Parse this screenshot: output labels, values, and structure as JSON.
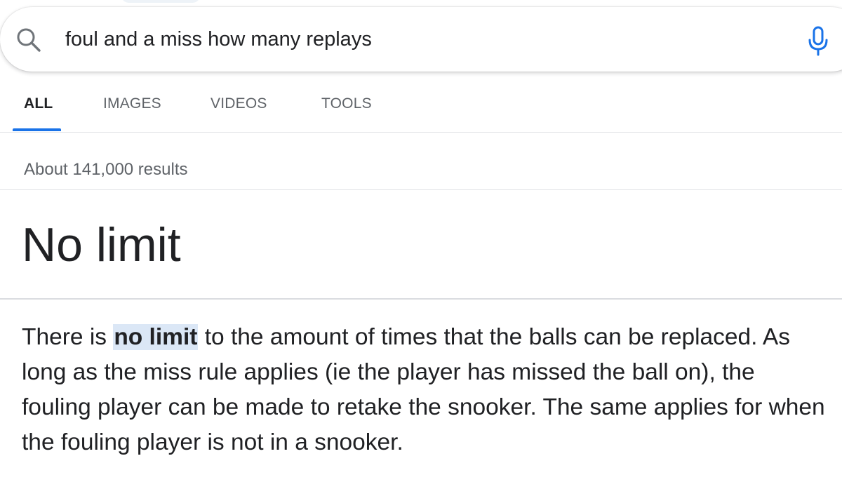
{
  "search": {
    "query": "foul and a miss how many replays",
    "search_icon": "search-icon",
    "mic_icon": "mic-icon"
  },
  "tabs": [
    {
      "label": "ALL",
      "active": true
    },
    {
      "label": "IMAGES",
      "active": false
    },
    {
      "label": "VIDEOS",
      "active": false
    },
    {
      "label": "TOOLS",
      "active": false
    }
  ],
  "results": {
    "count_text": "About 141,000 results"
  },
  "answer": {
    "title": "No limit",
    "snippet_before": "There is ",
    "snippet_highlight": "no limit",
    "snippet_after": " to the amount of times that the balls can be replaced. As long as the miss rule applies (ie the player has missed the ball on), the fouling player can be made to retake the snooker. The same applies for when the fouling player is not in a snooker."
  },
  "colors": {
    "accent": "#1a73e8",
    "text": "#202124",
    "muted": "#5f6368",
    "highlight": "#dbe7f6"
  }
}
